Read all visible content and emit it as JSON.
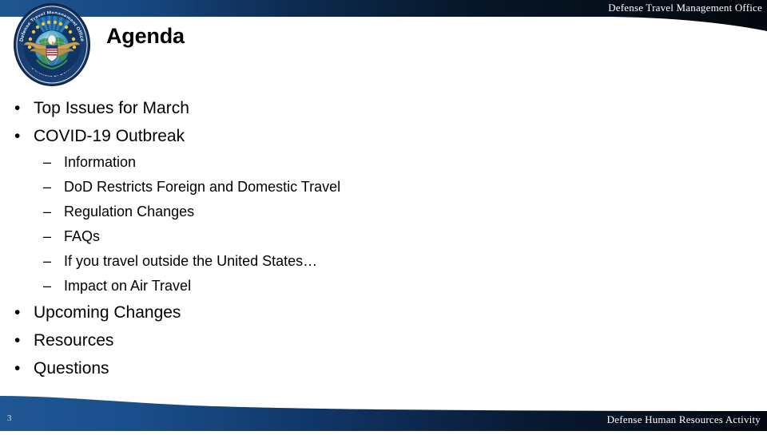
{
  "header": {
    "org_name": "Defense Travel Management Office",
    "logo": {
      "icon": "dod-dtmo-seal-icon",
      "top_arc_text": "Defense Travel Management Office",
      "bottom_arc_text": "Department of Defense"
    }
  },
  "slide": {
    "title": "Agenda",
    "bullets": [
      {
        "level": 1,
        "marker": "•",
        "text": "Top Issues for March"
      },
      {
        "level": 1,
        "marker": "•",
        "text": "COVID-19 Outbreak"
      },
      {
        "level": 2,
        "marker": "–",
        "text": "Information"
      },
      {
        "level": 2,
        "marker": "–",
        "text": "DoD Restricts Foreign and Domestic Travel"
      },
      {
        "level": 2,
        "marker": "–",
        "text": "Regulation Changes"
      },
      {
        "level": 2,
        "marker": "–",
        "text": "FAQs"
      },
      {
        "level": 2,
        "marker": "–",
        "text": "If you travel outside the United States…"
      },
      {
        "level": 2,
        "marker": "–",
        "text": "Impact on Air Travel"
      },
      {
        "level": 1,
        "marker": "•",
        "text": "Upcoming Changes"
      },
      {
        "level": 1,
        "marker": "•",
        "text": "Resources"
      },
      {
        "level": 1,
        "marker": "•",
        "text": "Questions"
      }
    ]
  },
  "footer": {
    "slide_number": "3",
    "org_name": "Defense Human Resources Activity"
  },
  "colors": {
    "band_blue_left": "#1d4f8f",
    "band_dark_right": "#050a12",
    "text_black": "#000000",
    "text_white": "#ffffff",
    "slide_number_text": "#cfe0f2",
    "page_background": "#ffffff"
  }
}
